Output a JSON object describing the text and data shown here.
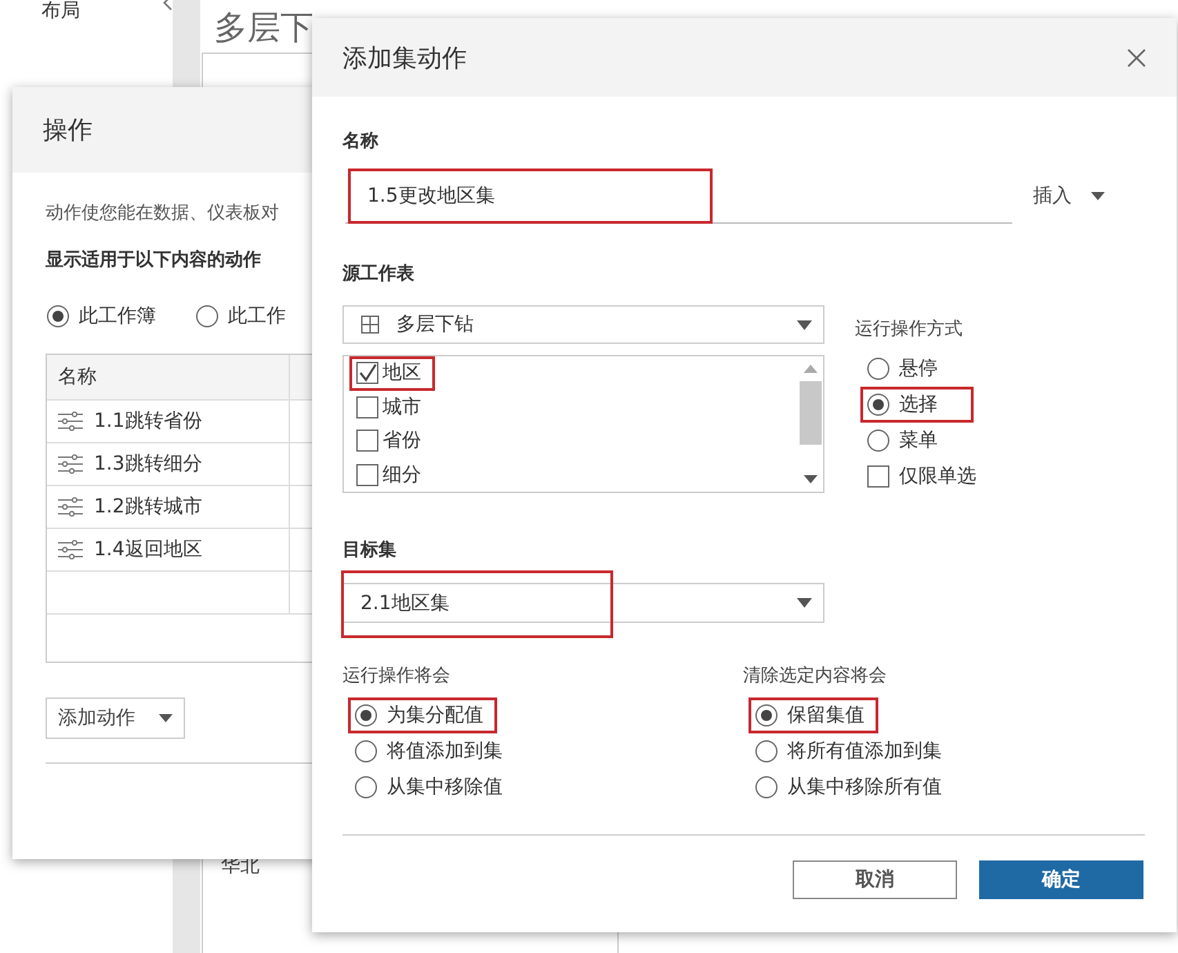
{
  "background": {
    "sidebar_title": "布局",
    "page_title": "多层下",
    "bottom_text": "华北"
  },
  "actions_dialog": {
    "title": "操作",
    "description": "动作使您能在数据、仪表板对",
    "filter_label": "显示适用于以下内容的动作",
    "scope_options": [
      {
        "label": "此工作簿",
        "selected": true
      },
      {
        "label": "此工作",
        "selected": false
      }
    ],
    "table": {
      "columns": [
        "名称"
      ],
      "rows": [
        "1.1跳转省份",
        "1.3跳转细分",
        "1.2跳转城市",
        "1.4返回地区"
      ]
    },
    "add_button": "添加动作"
  },
  "set_action_dialog": {
    "title": "添加集动作",
    "name_label": "名称",
    "name_value": "1.5更改地区集",
    "name_annotated": true,
    "insert_button": "插入",
    "source_label": "源工作表",
    "source_sheet": "多层下钻",
    "source_fields": [
      {
        "label": "地区",
        "checked": true,
        "annotated": true
      },
      {
        "label": "城市",
        "checked": false,
        "annotated": false
      },
      {
        "label": "省份",
        "checked": false,
        "annotated": false
      },
      {
        "label": "细分",
        "checked": false,
        "annotated": false
      }
    ],
    "run_on_label": "运行操作方式",
    "run_on_options": [
      {
        "label": "悬停",
        "selected": false,
        "annotated": false
      },
      {
        "label": "选择",
        "selected": true,
        "annotated": true
      },
      {
        "label": "菜单",
        "selected": false,
        "annotated": false
      }
    ],
    "single_select": {
      "label": "仅限单选",
      "checked": false
    },
    "target_label": "目标集",
    "target_set": "2.1地区集",
    "target_annotated": true,
    "run_action_label": "运行操作将会",
    "run_action_options": [
      {
        "label": "为集分配值",
        "selected": true,
        "annotated": true
      },
      {
        "label": "将值添加到集",
        "selected": false,
        "annotated": false
      },
      {
        "label": "从集中移除值",
        "selected": false,
        "annotated": false
      }
    ],
    "clear_label": "清除选定内容将会",
    "clear_options": [
      {
        "label": "保留集值",
        "selected": true,
        "annotated": true
      },
      {
        "label": "将所有值添加到集",
        "selected": false,
        "annotated": false
      },
      {
        "label": "从集中移除所有值",
        "selected": false,
        "annotated": false
      }
    ],
    "buttons": [
      {
        "label": "取消",
        "kind": "secondary"
      },
      {
        "label": "确定",
        "kind": "primary"
      }
    ]
  }
}
